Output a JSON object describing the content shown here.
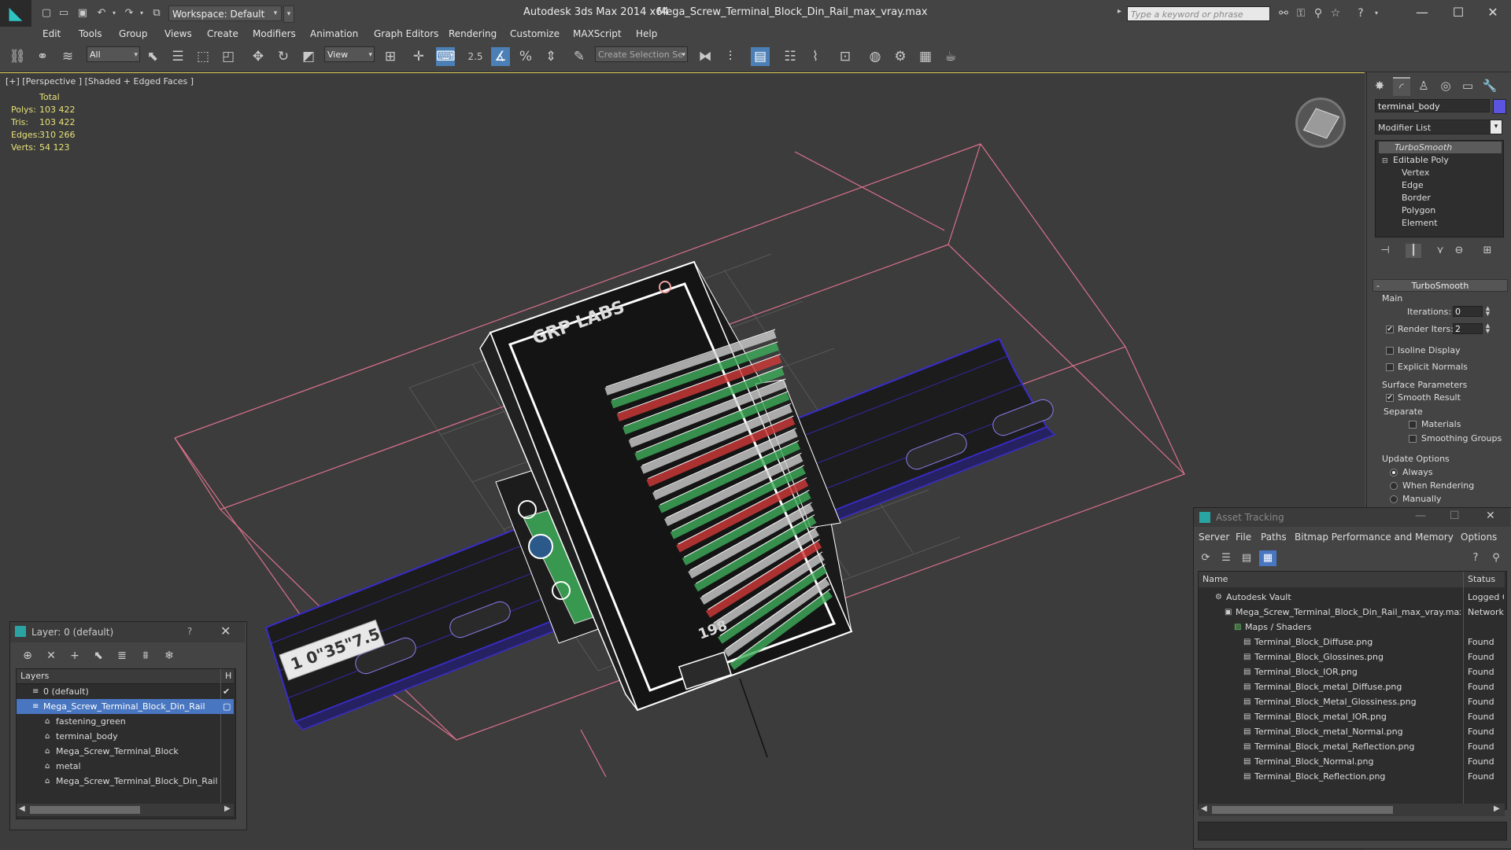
{
  "titlebar": {
    "workspace": "Workspace: Default",
    "app_title": "Autodesk 3ds Max  2014 x64",
    "file_title": "Mega_Screw_Terminal_Block_Din_Rail_max_vray.max",
    "search_placeholder": "Type a keyword or phrase"
  },
  "menu": [
    "Edit",
    "Tools",
    "Group",
    "Views",
    "Create",
    "Modifiers",
    "Animation",
    "Graph Editors",
    "Rendering",
    "Customize",
    "MAXScript",
    "Help"
  ],
  "toolbar": {
    "selection_filter": "All",
    "reference_coord": "View",
    "snap_angle_label": "2.5",
    "named_selection_placeholder": "Create Selection Se"
  },
  "viewport": {
    "label": "[+] [Perspective ] [Shaded + Edged Faces ]",
    "stats": {
      "header": "Total",
      "rows": [
        {
          "label": "Polys:",
          "value": "103 422"
        },
        {
          "label": "Tris:",
          "value": "103 422"
        },
        {
          "label": "Edges:",
          "value": "310 266"
        },
        {
          "label": "Verts:",
          "value": "54 123"
        }
      ]
    },
    "model_labels": {
      "brand": "GRP LABS",
      "rail_text": "1 0\"35\"7.5",
      "bottom_text": "198"
    },
    "colors": {
      "background": "#3c3c3c",
      "wire": "#ffffff",
      "rail": "#3a2ccc",
      "bbox": "#d9708c",
      "grid": "#5a5a5a",
      "terminal_green": "#3fae5a",
      "terminal_red": "#d23a3a"
    }
  },
  "command_panel": {
    "object_name": "terminal_body",
    "object_color": "#5a54e0",
    "modifier_list": "Modifier List",
    "stack": [
      {
        "label": "TurboSmooth",
        "level": 0,
        "selected": true
      },
      {
        "label": "Editable Poly",
        "level": 0,
        "selected": false
      },
      {
        "label": "Vertex",
        "level": 1,
        "selected": false
      },
      {
        "label": "Edge",
        "level": 1,
        "selected": false
      },
      {
        "label": "Border",
        "level": 1,
        "selected": false
      },
      {
        "label": "Polygon",
        "level": 1,
        "selected": false
      },
      {
        "label": "Element",
        "level": 1,
        "selected": false
      }
    ],
    "turbosmooth": {
      "rollout_title": "TurboSmooth",
      "main_label": "Main",
      "iterations_label": "Iterations:",
      "iterations_value": "0",
      "render_iters_label": "Render Iters:",
      "render_iters_value": "2",
      "render_iters_checked": true,
      "isoline_label": "Isoline Display",
      "explicit_normals_label": "Explicit Normals",
      "surface_params_label": "Surface Parameters",
      "smooth_result_label": "Smooth Result",
      "separate_label": "Separate",
      "materials_label": "Materials",
      "smoothing_groups_label": "Smoothing Groups",
      "update_options_label": "Update Options",
      "always_label": "Always",
      "when_rendering_label": "When Rendering",
      "manually_label": "Manually"
    }
  },
  "layer_dialog": {
    "title": "Layer: 0 (default)",
    "help": "?",
    "col_layers": "Layers",
    "col_h": "H",
    "rows": [
      {
        "label": "0 (default)",
        "indent": 1,
        "selected": false,
        "check": "✔"
      },
      {
        "label": "Mega_Screw_Terminal_Block_Din_Rail",
        "indent": 1,
        "selected": true,
        "check": ""
      },
      {
        "label": "fastening_green",
        "indent": 2,
        "selected": false,
        "check": ""
      },
      {
        "label": "terminal_body",
        "indent": 2,
        "selected": false,
        "check": ""
      },
      {
        "label": "Mega_Screw_Terminal_Block",
        "indent": 2,
        "selected": false,
        "check": ""
      },
      {
        "label": "metal",
        "indent": 2,
        "selected": false,
        "check": ""
      },
      {
        "label": "Mega_Screw_Terminal_Block_Din_Rail",
        "indent": 2,
        "selected": false,
        "check": ""
      }
    ]
  },
  "asset_tracking": {
    "title": "Asset Tracking",
    "menu": [
      "Server",
      "File",
      "Paths",
      "Bitmap Performance and Memory",
      "Options"
    ],
    "col_name": "Name",
    "col_status": "Status",
    "rows": [
      {
        "name": "Autodesk Vault",
        "status": "Logged C",
        "indent": 1,
        "icon": "vault-icon"
      },
      {
        "name": "Mega_Screw_Terminal_Block_Din_Rail_max_vray.max",
        "status": "Network",
        "indent": 2,
        "icon": "max-file-icon"
      },
      {
        "name": "Maps / Shaders",
        "status": "",
        "indent": 3,
        "icon": "maps-icon"
      },
      {
        "name": "Terminal_Block_Diffuse.png",
        "status": "Found",
        "indent": 4,
        "icon": "image-file-icon"
      },
      {
        "name": "Terminal_Block_Glossines.png",
        "status": "Found",
        "indent": 4,
        "icon": "image-file-icon"
      },
      {
        "name": "Terminal_Block_IOR.png",
        "status": "Found",
        "indent": 4,
        "icon": "image-file-icon"
      },
      {
        "name": "Terminal_Block_metal_Diffuse.png",
        "status": "Found",
        "indent": 4,
        "icon": "image-file-icon"
      },
      {
        "name": "Terminal_Block_Metal_Glossiness.png",
        "status": "Found",
        "indent": 4,
        "icon": "image-file-icon"
      },
      {
        "name": "Terminal_Block_metal_IOR.png",
        "status": "Found",
        "indent": 4,
        "icon": "image-file-icon"
      },
      {
        "name": "Terminal_Block_metal_Normal.png",
        "status": "Found",
        "indent": 4,
        "icon": "image-file-icon"
      },
      {
        "name": "Terminal_Block_metal_Reflection.png",
        "status": "Found",
        "indent": 4,
        "icon": "image-file-icon"
      },
      {
        "name": "Terminal_Block_Normal.png",
        "status": "Found",
        "indent": 4,
        "icon": "image-file-icon"
      },
      {
        "name": "Terminal_Block_Reflection.png",
        "status": "Found",
        "indent": 4,
        "icon": "image-file-icon"
      }
    ]
  }
}
